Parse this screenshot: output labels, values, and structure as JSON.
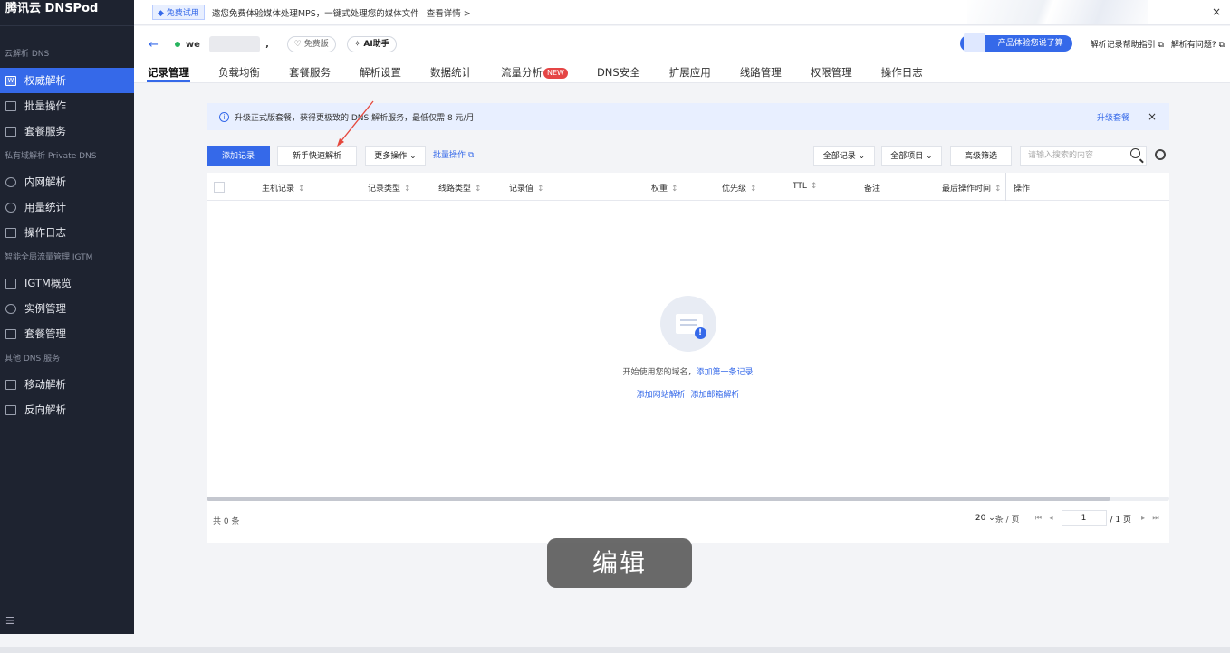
{
  "sidebar": {
    "brand": "腾讯云 DNSPod",
    "sections": [
      "云解析 DNS",
      "私有域解析 Private DNS",
      "智能全局流量管理 IGTM",
      "其他 DNS 服务"
    ],
    "items": [
      "权威解析",
      "批量操作",
      "套餐服务",
      "内网解析",
      "用量统计",
      "操作日志",
      "IGTM概览",
      "实例管理",
      "套餐管理",
      "移动解析",
      "反向解析"
    ],
    "collapse_icon": "menu-collapse-icon"
  },
  "notice": {
    "tag": "免费试用",
    "text": "邀您免费体验媒体处理MPS，一键式处理您的媒体文件",
    "more": "查看详情 >",
    "close": "×"
  },
  "domain": {
    "back": "←",
    "name": "we",
    "tail": "‚",
    "plan": "免费版",
    "ai": "AI助手",
    "feedback": "产品体验您说了算",
    "help1": "解析记录帮助指引",
    "help2": "解析有问题?"
  },
  "tabs": [
    "记录管理",
    "负载均衡",
    "套餐服务",
    "解析设置",
    "数据统计",
    "流量分析",
    "DNS安全",
    "扩展应用",
    "线路管理",
    "权限管理",
    "操作日志"
  ],
  "new_badge": "NEW",
  "info": {
    "text": "升级正式版套餐，获得更极致的 DNS 解析服务，最低仅需 8 元/月",
    "upgrade": "升级套餐",
    "close": "×"
  },
  "toolbar": {
    "add": "添加记录",
    "quick": "新手快速解析",
    "more": "更多操作",
    "batch": "批量操作",
    "all_records": "全部记录",
    "all_items": "全部项目",
    "adv_filter": "高级筛选",
    "search_placeholder": "请输入搜索的内容"
  },
  "table": {
    "headers": [
      "主机记录",
      "记录类型",
      "线路类型",
      "记录值",
      "权重",
      "优先级",
      "TTL",
      "备注",
      "最后操作时间",
      "操作"
    ],
    "sort_glyph": "↕",
    "empty_text": "开始使用您的域名，",
    "empty_link": "添加第一条记录",
    "link_web": "添加网站解析",
    "link_mail": "添加邮箱解析",
    "total": "共 0 条",
    "page_size": "20",
    "per_page": "条 / 页",
    "page": "1",
    "page_total": "/ 1 页"
  },
  "toast": "编辑"
}
